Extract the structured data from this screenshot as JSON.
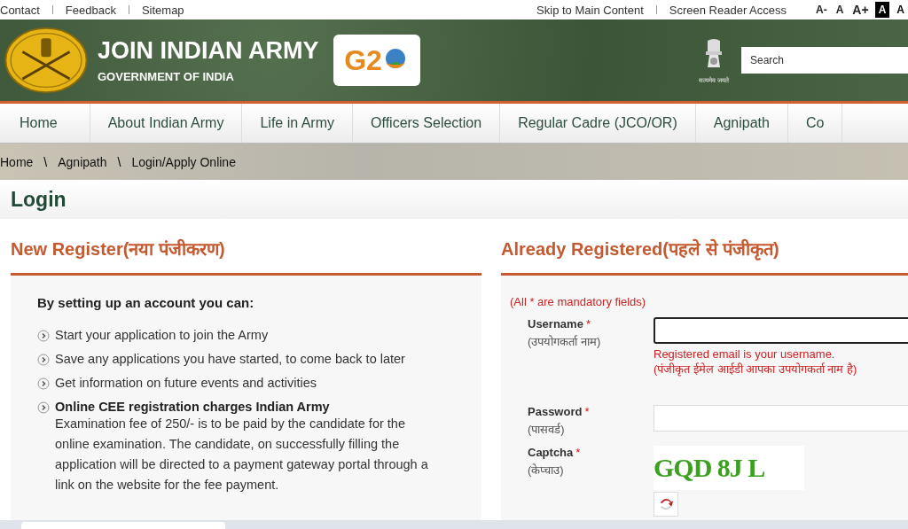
{
  "top_links": [
    "Contact",
    "Feedback",
    "Sitemap"
  ],
  "access_links": [
    "Skip to Main Content",
    "Screen Reader Access"
  ],
  "font_sizes": [
    "A-",
    "A",
    "A+"
  ],
  "contrast": [
    {
      "label": "A",
      "selected": true
    },
    {
      "label": "A",
      "selected": false
    }
  ],
  "header": {
    "title": "JOIN INDIAN ARMY",
    "subtitle": "GOVERNMENT OF INDIA",
    "g20_logo": "G2",
    "emblem_motto": "सत्यमेव जयते",
    "search": {
      "placeholder": "Search"
    }
  },
  "nav": [
    "Home",
    "About Indian Army",
    "Life in Army",
    "Officers Selection",
    "Regular Cadre (JCO/OR)",
    "Agnipath",
    "Co"
  ],
  "breadcrumb": {
    "separator": "\\",
    "items": [
      "Home",
      "Agnipath",
      "Login/Apply Online"
    ]
  },
  "page_title": "Login",
  "new_register": {
    "title": "New Register(नया पंजीकरण)",
    "intro": "By setting up an account you can:",
    "items": [
      {
        "kind": "plain",
        "text": "Start your application to join the Army"
      },
      {
        "kind": "plain",
        "text": "Save any applications you have started, to come back to later"
      },
      {
        "kind": "plain",
        "text": "Get information on future events and activities"
      },
      {
        "kind": "detail",
        "text": "Online CEE registration charges Indian Army",
        "detail": "Examination fee of 250/- is to be paid by the candidate for the online examination. The candidate, on successfully filling the application will be directed to a payment gateway portal through a link on the website for the fee payment."
      }
    ]
  },
  "already_registered": {
    "title": "Already Registered(पहले से पंजीकृत)",
    "note": "(All * are mandatory fields)",
    "fields": [
      {
        "kind": "text",
        "label": "Username",
        "required_mark": "*",
        "label_hi": "(उपयोगकर्ता नाम)",
        "focused": true,
        "hint": "Registered email is your username.",
        "hint_hi": "(पंजीकृत ईमेल आईडी आपका उपयोगकर्ता नाम है)"
      },
      {
        "kind": "password",
        "label": "Password",
        "required_mark": "*",
        "label_hi": "(पासवर्ड)",
        "focused": false
      },
      {
        "kind": "captcha",
        "label": "Captcha",
        "required_mark": "*",
        "label_hi": "(केप्चाउ)",
        "captcha_text": "GQD 8J L"
      }
    ]
  }
}
